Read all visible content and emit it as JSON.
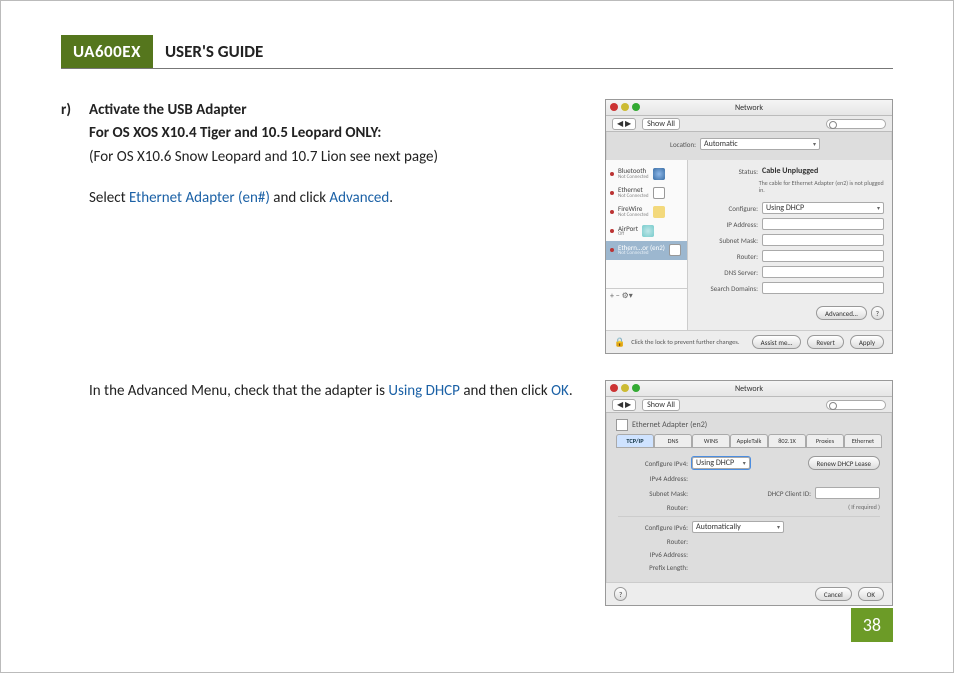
{
  "header": {
    "brand": "UA600EX",
    "title": "USER'S GUIDE"
  },
  "step": {
    "marker": "r)",
    "line1": "Activate the USB Adapter",
    "line2": "For OS XOS X10.4 Tiger and 10.5 Leopard ONLY:",
    "line3": "(For OS X10.6 Snow Leopard and 10.7 Lion see next page)",
    "l4a": "Select ",
    "l4b": "Ethernet Adapter (en#)",
    "l4c": " and click ",
    "l4d": "Advanced",
    "l4e": "."
  },
  "fig1": {
    "winTitle": "Network",
    "showAll": "Show All",
    "location_lbl": "Location:",
    "location_val": "Automatic",
    "sidebar": [
      {
        "name": "Bluetooth",
        "sub": "Not Connected"
      },
      {
        "name": "Ethernet",
        "sub": "Not Connected"
      },
      {
        "name": "FireWire",
        "sub": "Not Connected"
      },
      {
        "name": "AirPort",
        "sub": "Off"
      },
      {
        "name": "Ethern...or (en2)",
        "sub": "Not Connected"
      }
    ],
    "status_lbl": "Status:",
    "status_val": "Cable Unplugged",
    "status_note": "The cable for Ethernet Adapter (en2) is not plugged in.",
    "configure_lbl": "Configure:",
    "configure_val": "Using DHCP",
    "fields": [
      "IP Address:",
      "Subnet Mask:",
      "Router:",
      "DNS Server:",
      "Search Domains:"
    ],
    "adv_btn": "Advanced…",
    "help": "?",
    "lock_note": "Click the lock to prevent further changes.",
    "assist": "Assist me…",
    "revert": "Revert",
    "apply": "Apply"
  },
  "para2": {
    "a": "In the Advanced Menu, check that the adapter is ",
    "b": "Using DHCP",
    "c": " and then click ",
    "d": "OK",
    "e": "."
  },
  "fig2": {
    "winTitle": "Network",
    "showAll": "Show All",
    "adapter": "Ethernet Adapter (en2)",
    "tabs": [
      "TCP/IP",
      "DNS",
      "WINS",
      "AppleTalk",
      "802.1X",
      "Proxies",
      "Ethernet"
    ],
    "cfg4_lbl": "Configure IPv4:",
    "cfg4_val": "Using DHCP",
    "renew": "Renew DHCP Lease",
    "ip4": "IPv4 Address:",
    "mask": "Subnet Mask:",
    "router": "Router:",
    "dhcpid_lbl": "DHCP Client ID:",
    "dhcpid_note": "( If required )",
    "cfg6_lbl": "Configure IPv6:",
    "cfg6_val": "Automatically",
    "router6": "Router:",
    "ip6": "IPv6 Address:",
    "plen": "Prefix Length:",
    "cancel": "Cancel",
    "ok": "OK"
  },
  "pageNumber": "38"
}
